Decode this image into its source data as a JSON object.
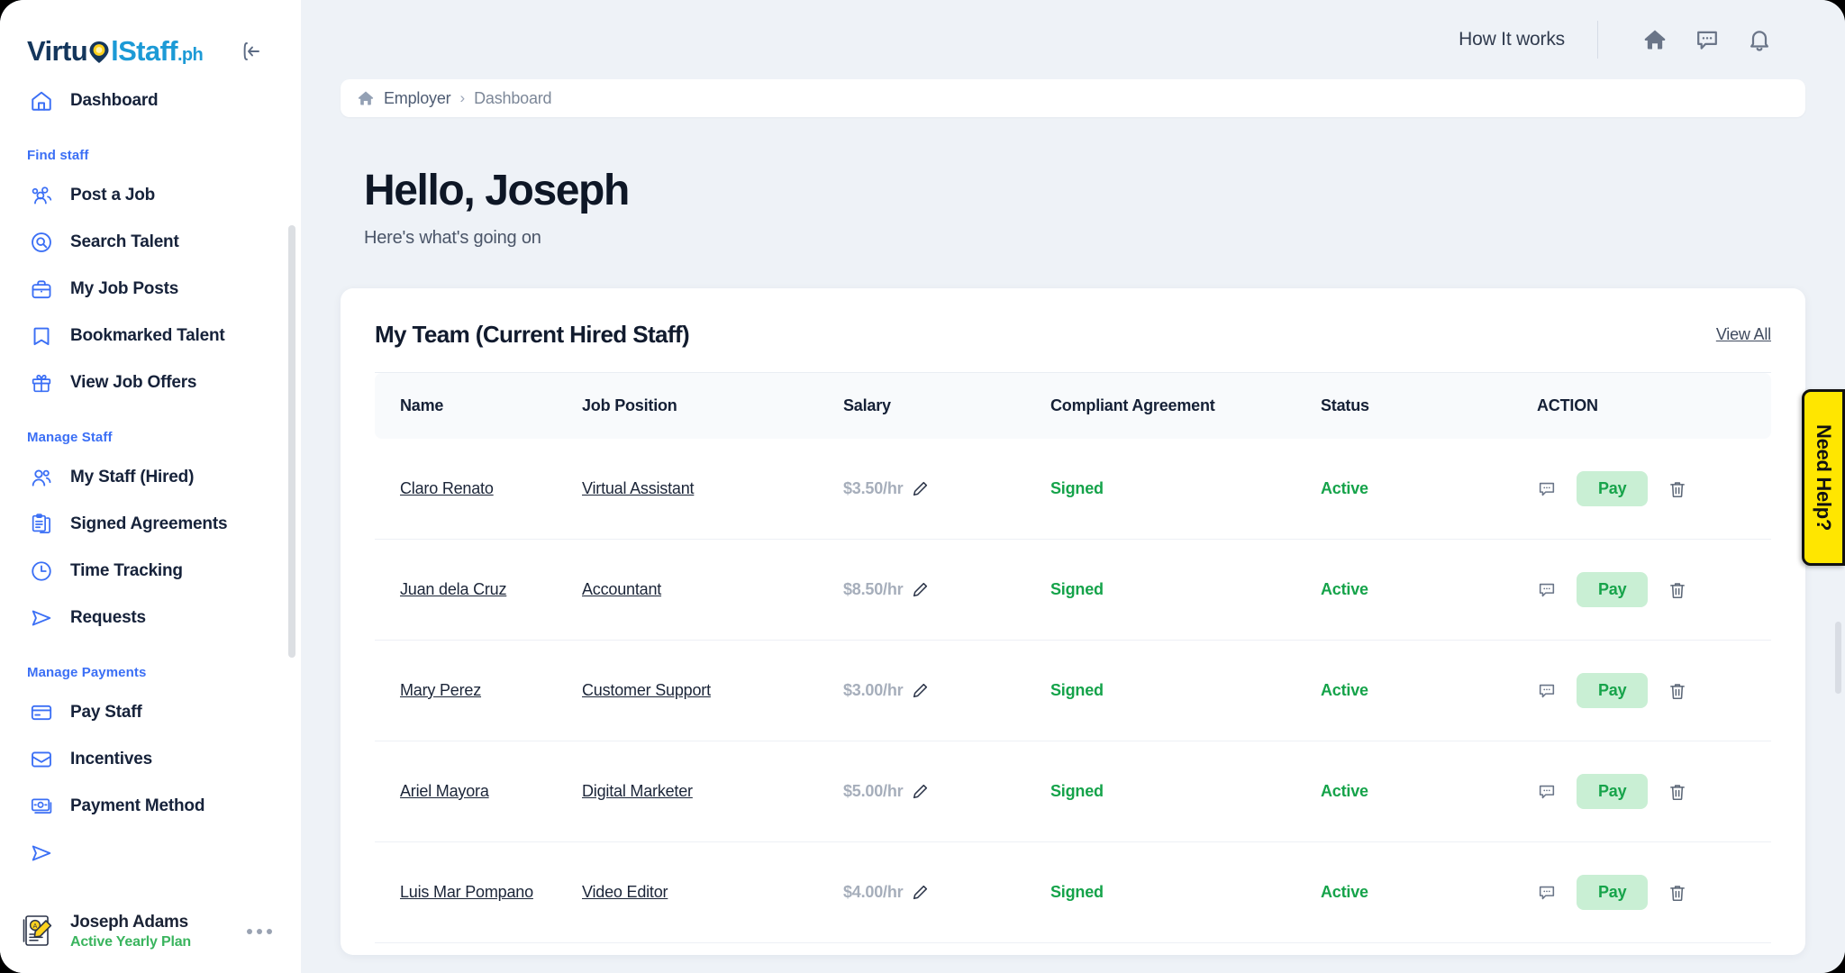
{
  "brand": {
    "logo_part1": "Virtu",
    "logo_part2": "lStaff",
    "logo_suffix": ".ph",
    "accent_blue": "#3b6ff5",
    "brand_dark": "#14365c",
    "brand_cyan": "#1c9ad6"
  },
  "sidebar": {
    "collapse_label": "Collapse sidebar",
    "items": [
      {
        "label": "Dashboard",
        "icon": "home-icon",
        "group": null
      }
    ],
    "groups": [
      {
        "label": "Find staff",
        "items": [
          {
            "label": "Post a Job",
            "icon": "users-group-icon"
          },
          {
            "label": "Search Talent",
            "icon": "search-circle-icon"
          },
          {
            "label": "My Job Posts",
            "icon": "briefcase-icon"
          },
          {
            "label": "Bookmarked Talent",
            "icon": "bookmark-icon"
          },
          {
            "label": "View Job Offers",
            "icon": "gift-icon"
          }
        ]
      },
      {
        "label": "Manage Staff",
        "items": [
          {
            "label": "My Staff (Hired)",
            "icon": "people-icon"
          },
          {
            "label": "Signed Agreements",
            "icon": "clipboard-icon"
          },
          {
            "label": "Time Tracking",
            "icon": "clock-icon"
          },
          {
            "label": "Requests",
            "icon": "send-icon"
          }
        ]
      },
      {
        "label": "Manage Payments",
        "items": [
          {
            "label": "Pay Staff",
            "icon": "credit-card-icon"
          },
          {
            "label": "Incentives",
            "icon": "inbox-icon"
          },
          {
            "label": "Payment Method",
            "icon": "banknote-icon"
          }
        ]
      }
    ],
    "profile": {
      "name": "Joseph Adams",
      "plan": "Active Yearly Plan",
      "plan_color": "#3ab45e",
      "menu_icon": "ellipsis-icon",
      "avatar_icon": "profile-document-icon"
    }
  },
  "topbar": {
    "how_it_works": "How It works",
    "icons": [
      "home-icon",
      "chat-icon",
      "bell-icon"
    ]
  },
  "breadcrumb": {
    "home_icon": "home-icon",
    "root": "Employer",
    "separator": "›",
    "current": "Dashboard"
  },
  "greeting": {
    "title": "Hello, Joseph",
    "subtitle": "Here's what's going on"
  },
  "team_card": {
    "title": "My Team (Current Hired Staff)",
    "view_all": "View All",
    "columns": [
      "Name",
      "Job Position",
      "Salary",
      "Compliant Agreement",
      "Status",
      "ACTION"
    ],
    "rows": [
      {
        "name": "Claro Renato",
        "position": "Virtual Assistant",
        "salary": "$3.50/hr",
        "agreement": "Signed",
        "status": "Active",
        "pay_label": "Pay"
      },
      {
        "name": "Juan dela Cruz",
        "position": "Accountant",
        "salary": "$8.50/hr",
        "agreement": "Signed",
        "status": "Active",
        "pay_label": "Pay"
      },
      {
        "name": "Mary Perez",
        "position": "Customer Support",
        "salary": "$3.00/hr",
        "agreement": "Signed",
        "status": "Active",
        "pay_label": "Pay"
      },
      {
        "name": "Ariel Mayora",
        "position": "Digital Marketer",
        "salary": "$5.00/hr",
        "agreement": "Signed",
        "status": "Active",
        "pay_label": "Pay"
      },
      {
        "name": "Luis Mar Pompano",
        "position": "Video Editor",
        "salary": "$4.00/hr",
        "agreement": "Signed",
        "status": "Active",
        "pay_label": "Pay"
      }
    ],
    "status_color": "#15a34a",
    "pay_bg": "#c9efd4"
  },
  "help_tab": {
    "label": "Need Help?",
    "bg": "#ffe600",
    "text_color": "#111111"
  }
}
